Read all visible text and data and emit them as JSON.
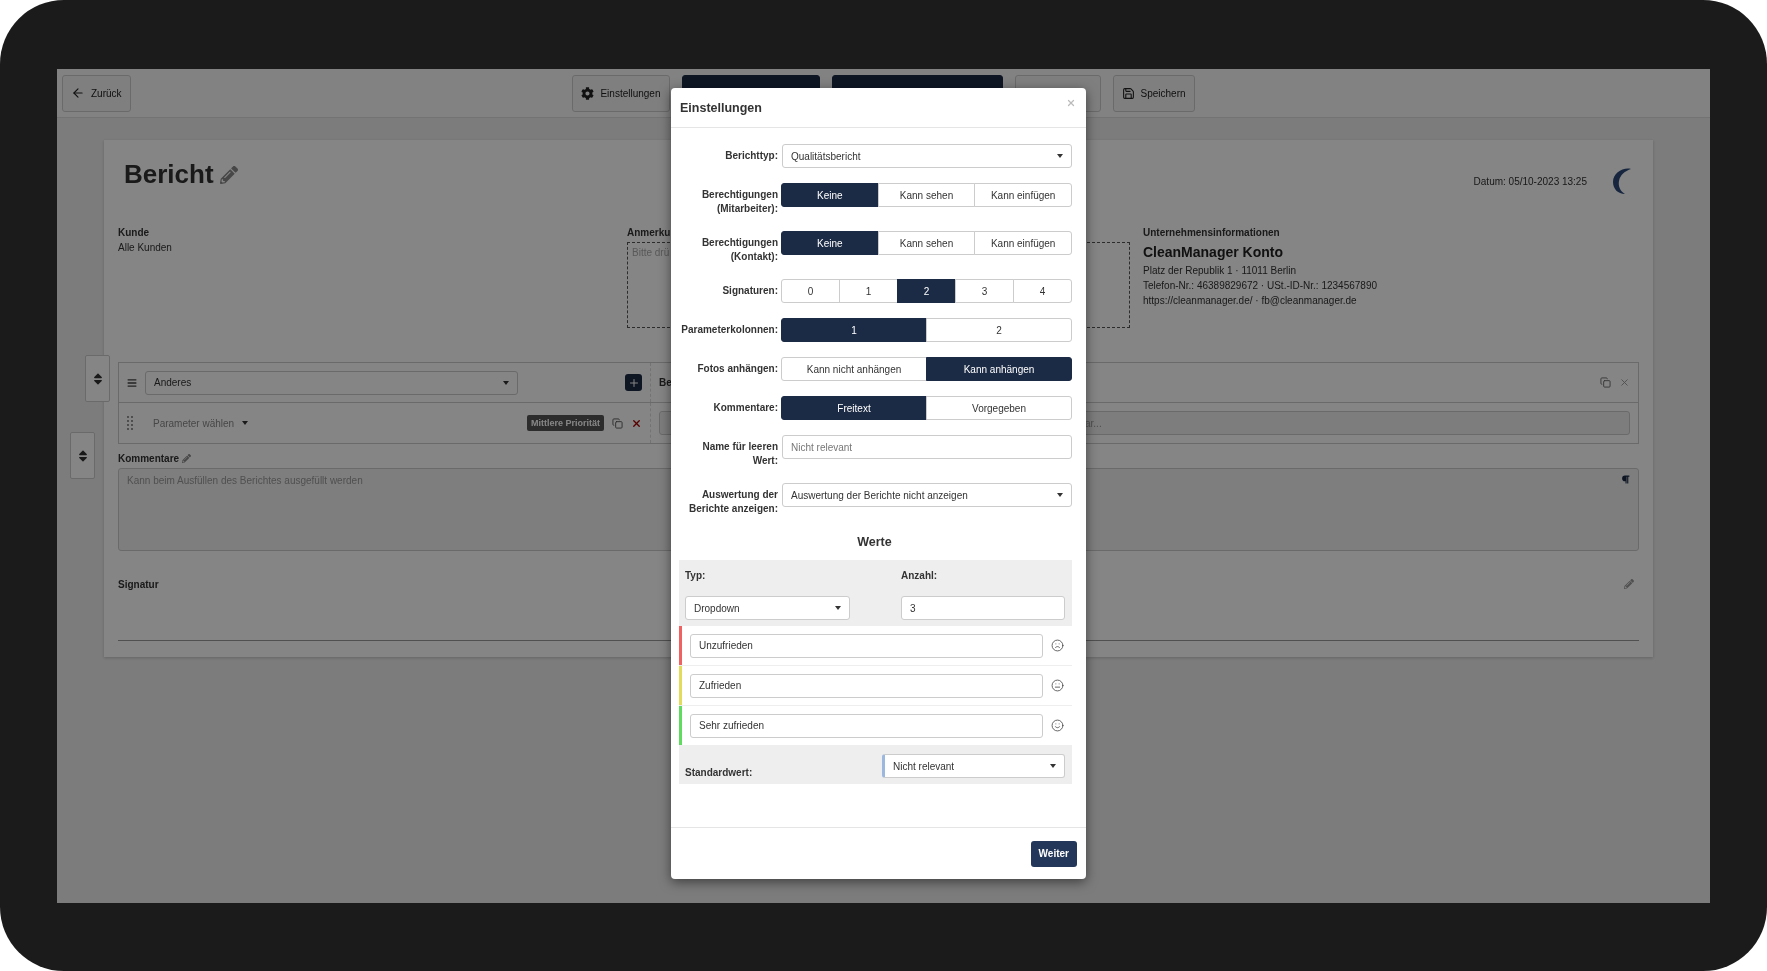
{
  "toolbar": {
    "back": "Zurück",
    "buttons": [
      {
        "kind": "settings",
        "label": "Einstellungen"
      },
      {
        "kind": "primary"
      },
      {
        "kind": "primary"
      },
      {
        "kind": "outline"
      },
      {
        "kind": "save",
        "label": "Speichern"
      }
    ]
  },
  "report": {
    "title": "Bericht",
    "date": "Datum: 05/10-2023 13:25",
    "customer_label": "Kunde",
    "customer": "Alle Kunden",
    "note_label": "Anmerku",
    "note_placeholder": "Bitte drü",
    "company_label": "Unternehmensinformationen",
    "company_name": "CleanManager Konto",
    "company_lines": [
      "Platz der Republik 1 · 11011 Berlin",
      "Telefon-Nr.: 46389829672 · USt.-ID-Nr.: 1234567890",
      "https://cleanmanager.de/ · fb@cleanmanager.de"
    ],
    "parameter": {
      "category": "Anderes",
      "parameter_placeholder": "Parameter wählen",
      "priority": "Mittlere Priorität",
      "column_2_label": "Be",
      "column_2_placeholder": "ar..."
    },
    "comments_label": "Kommentare",
    "comments_placeholder": "Kann beim Ausfüllen des Berichtes ausgefüllt werden",
    "signature_label": "Signatur"
  },
  "dialog": {
    "title": "Einstellungen",
    "fields": [
      {
        "kind": "select",
        "label": "Berichttyp:",
        "value": "Qualitätsbericht"
      },
      {
        "kind": "segmented",
        "label": "Berechtigungen (Mitarbeiter):",
        "options": [
          {
            "label": "Keine",
            "selected": true
          },
          {
            "label": "Kann sehen",
            "selected": false
          },
          {
            "label": "Kann einfügen",
            "selected": false
          }
        ]
      },
      {
        "kind": "segmented",
        "label": "Berechtigungen (Kontakt):",
        "options": [
          {
            "label": "Keine",
            "selected": true
          },
          {
            "label": "Kann sehen",
            "selected": false
          },
          {
            "label": "Kann einfügen",
            "selected": false
          }
        ]
      },
      {
        "kind": "segmented",
        "label": "Signaturen:",
        "options": [
          {
            "label": "0",
            "selected": false
          },
          {
            "label": "1",
            "selected": false
          },
          {
            "label": "2",
            "selected": true
          },
          {
            "label": "3",
            "selected": false
          },
          {
            "label": "4",
            "selected": false
          }
        ]
      },
      {
        "kind": "segmented",
        "label": "Parameterkolonnen:",
        "options": [
          {
            "label": "1",
            "selected": true
          },
          {
            "label": "2",
            "selected": false
          }
        ]
      },
      {
        "kind": "segmented",
        "label": "Fotos anhängen:",
        "options": [
          {
            "label": "Kann nicht anhängen",
            "selected": false
          },
          {
            "label": "Kann anhängen",
            "selected": true
          }
        ]
      },
      {
        "kind": "segmented",
        "label": "Kommentare:",
        "options": [
          {
            "label": "Freitext",
            "selected": true
          },
          {
            "label": "Vorgegeben",
            "selected": false
          }
        ]
      },
      {
        "kind": "input",
        "label": "Name für leeren Wert:",
        "placeholder": "Nicht relevant"
      },
      {
        "kind": "select",
        "label": "Auswertung der Berichte anzeigen:",
        "value": "Auswertung der Berichte nicht anzeigen"
      }
    ],
    "values": {
      "title": "Werte",
      "type_label": "Typ:",
      "type_value": "Dropdown",
      "count_label": "Anzahl:",
      "count_value": "3",
      "items": [
        {
          "value": "Unzufrieden",
          "color": "#f06262",
          "kind": "sad"
        },
        {
          "value": "Zufrieden",
          "color": "#e2dc5a",
          "kind": "neutral"
        },
        {
          "value": "Sehr zufrieden",
          "color": "#5fdc5f",
          "kind": "happy"
        }
      ],
      "default_label": "Standardwert:",
      "default_value": "Nicht relevant"
    },
    "next_button": "Weiter"
  }
}
